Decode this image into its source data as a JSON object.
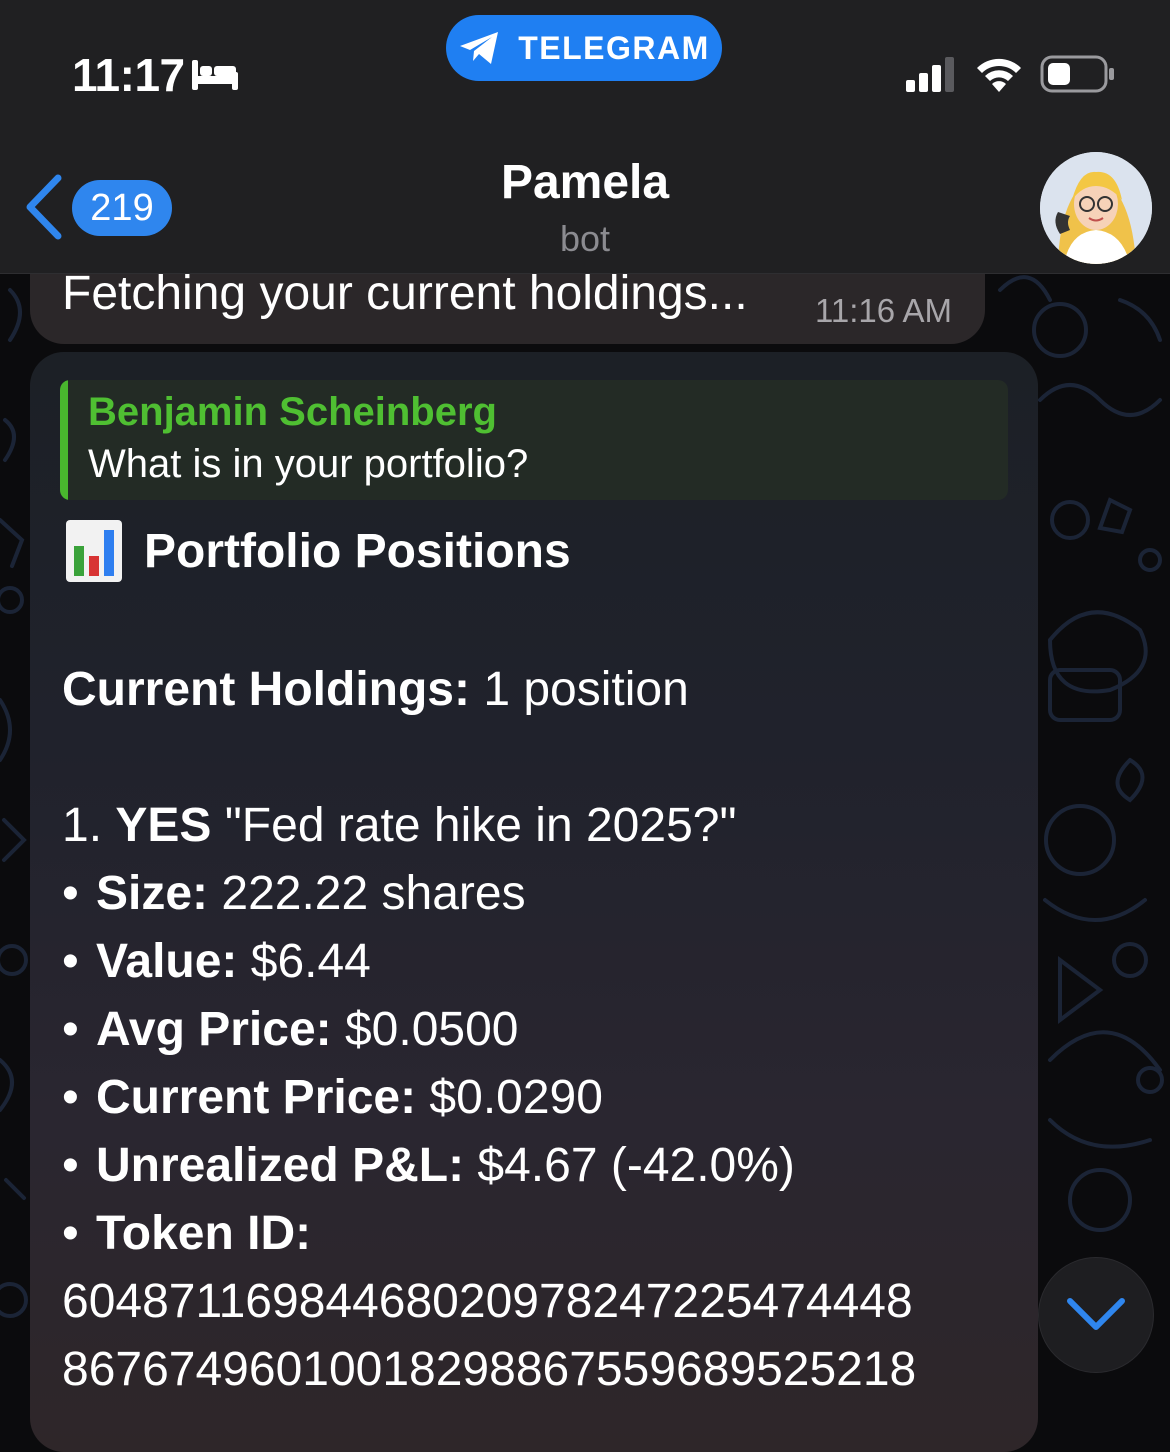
{
  "status_bar": {
    "time": "11:17",
    "app_return_label": "TELEGRAM",
    "icons": [
      "bed-icon",
      "telegram-plane-icon",
      "signal-icon",
      "wifi-icon",
      "battery-icon"
    ]
  },
  "chat_header": {
    "unread_count": "219",
    "title": "Pamela",
    "subtitle": "bot",
    "icons": [
      "back-chevron-icon",
      "avatar"
    ]
  },
  "messages": {
    "previous": {
      "text": "Fetching your current holdings...",
      "time": "11:16 AM"
    },
    "current": {
      "reply": {
        "author": "Benjamin Scheinberg",
        "text": "What is in your portfolio?"
      },
      "heading": "Portfolio Positions",
      "holdings": {
        "label": "Current Holdings:",
        "value": " 1 position"
      },
      "position": {
        "index": "1.",
        "side": "YES",
        "market": " \"Fed rate hike in 2025?\"",
        "bullet": "•",
        "size": {
          "label": "Size:",
          "value": " 222.22 shares"
        },
        "value": {
          "label": "Value:",
          "value": " $6.44"
        },
        "avg_price": {
          "label": "Avg Price:",
          "value": " $0.0500"
        },
        "current_price": {
          "label": "Current Price:",
          "value": " $0.0290"
        },
        "unrealized_pnl": {
          "label": "Unrealized P&L:",
          "value": " $4.67 (-42.0%)"
        },
        "token_id": {
          "label": "Token ID:",
          "line1": "60487116984468020978247225474448",
          "line2": "86767496010018298867559689525218"
        }
      }
    }
  },
  "colors": {
    "header_bg": "#202022",
    "accent_blue": "#2f86ee",
    "reply_green": "#4fbf32",
    "bubble_prev": "#2b2729",
    "wallpaper_doodle": "#1b2436"
  }
}
